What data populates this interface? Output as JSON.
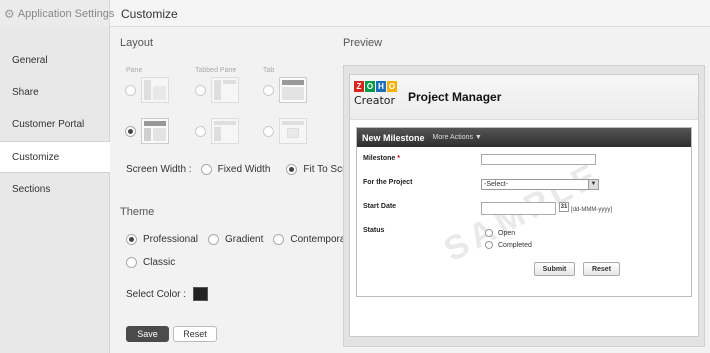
{
  "header": {
    "app_settings": "Application Settings",
    "title": "Customize"
  },
  "sidebar": {
    "items": [
      {
        "label": "General"
      },
      {
        "label": "Share"
      },
      {
        "label": "Customer Portal"
      },
      {
        "label": "Customize",
        "active": true
      },
      {
        "label": "Sections"
      }
    ]
  },
  "layout": {
    "heading": "Layout",
    "pane_labels": [
      "Pane",
      "Tabbed Pane",
      "Tab"
    ],
    "screen_width_label": "Screen Width :",
    "options": [
      "Fixed Width",
      "Fit To Screen"
    ],
    "selected": "Fit To Screen"
  },
  "theme": {
    "heading": "Theme",
    "options": [
      "Professional",
      "Gradient",
      "Contemporary",
      "Classic"
    ],
    "selected": "Professional",
    "select_color_label": "Select Color :",
    "color": "#222222"
  },
  "actions": {
    "save": "Save",
    "reset": "Reset"
  },
  "preview": {
    "heading": "Preview",
    "logo_letters": [
      "Z",
      "O",
      "H",
      "O"
    ],
    "logo_colors": [
      "#d9251d",
      "#089949",
      "#1d6ebc",
      "#f5b200"
    ],
    "logo_text": "Creator",
    "app_title": "Project Manager",
    "form_title": "New Milestone",
    "more_actions": "More Actions ▼",
    "fields": {
      "milestone": "Milestone",
      "required_mark": "*",
      "project": "For the Project",
      "project_value": "-Select-",
      "start_date": "Start Date",
      "calendar": "31",
      "date_format": "[dd-MMM-yyyy]",
      "status": "Status",
      "status_options": [
        "Open",
        "Completed"
      ]
    },
    "submit": "Submit",
    "reset": "Reset",
    "watermark": "SAMPLE"
  }
}
